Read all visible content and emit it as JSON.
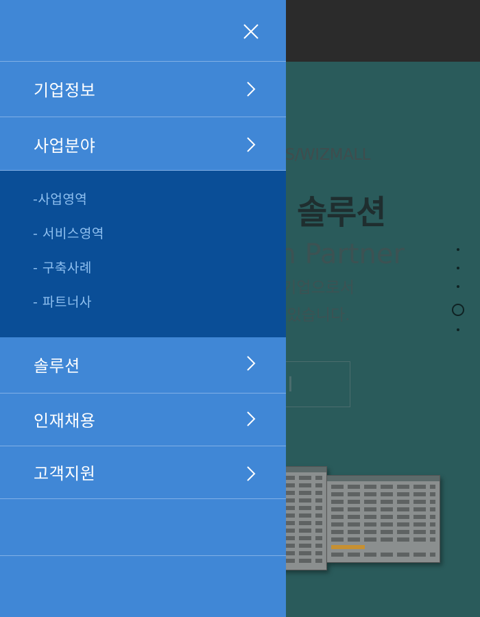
{
  "background": {
    "brand": "OS/WIZMALL",
    "title": "솔루션",
    "subtitle": "on Partner",
    "description_line1": "문기업으로서",
    "description_line2": "고 있습니다.",
    "button_label": "I"
  },
  "drawer": {
    "close_icon": "close-icon",
    "menu": [
      {
        "label": "기업정보"
      },
      {
        "label": "사업분야"
      },
      {
        "label": "솔루션"
      },
      {
        "label": "인재채용"
      },
      {
        "label": "고객지원"
      }
    ],
    "submenu": [
      {
        "label": "-사업영역"
      },
      {
        "label": "- 서비스영역"
      },
      {
        "label": "- 구축사례"
      },
      {
        "label": "- 파트너사"
      }
    ]
  },
  "colors": {
    "drawer_bg": "#4087d6",
    "submenu_bg": "#0a4e97",
    "submenu_text": "#8fc0f0",
    "page_bg": "#2a5b5b",
    "header_bg": "#2b2b2b"
  },
  "slider": {
    "total_slides": 5,
    "active_slide": 4
  }
}
